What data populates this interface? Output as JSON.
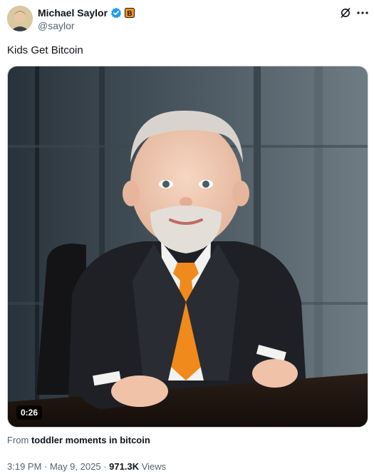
{
  "author": {
    "display_name": "Michael Saylor",
    "handle": "@saylor",
    "verified_icon": "verified-badge-icon",
    "affiliation_icon": "bitcoin-b-badge-icon",
    "affiliation_color": "#f7931a",
    "verified_color": "#1d9bf0"
  },
  "header_icons": {
    "grok": "grok-icon",
    "more": "more-dots-icon"
  },
  "tweet": {
    "text": "Kids Get Bitcoin"
  },
  "media": {
    "duration": "0:26",
    "tie_color": "#f08a1c",
    "suit_color": "#1e2026"
  },
  "community": {
    "prefix": "From",
    "name": "toddler moments in bitcoin"
  },
  "meta": {
    "time": "3:19 PM",
    "separator": "·",
    "date": "May 9, 2025",
    "views_count": "971.3K",
    "views_label": "Views"
  }
}
